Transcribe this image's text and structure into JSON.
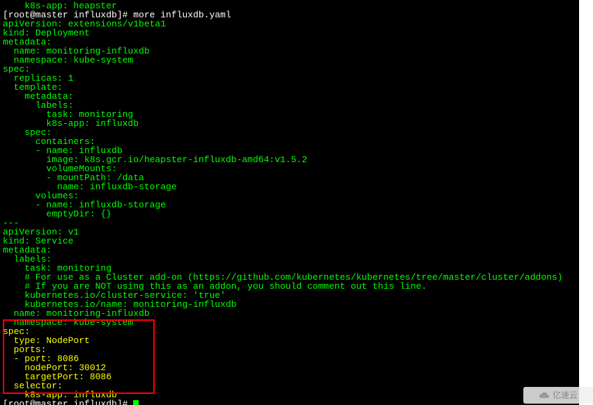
{
  "lines": [
    {
      "text": "    k8s-app: heapster",
      "cls": "green"
    },
    {
      "text": "[root@master influxdb]# more influxdb.yaml",
      "cls": "white"
    },
    {
      "text": "apiVersion: extensions/v1beta1",
      "cls": "green"
    },
    {
      "text": "kind: Deployment",
      "cls": "green"
    },
    {
      "text": "metadata:",
      "cls": "green"
    },
    {
      "text": "  name: monitoring-influxdb",
      "cls": "green"
    },
    {
      "text": "  namespace: kube-system",
      "cls": "green"
    },
    {
      "text": "spec:",
      "cls": "green"
    },
    {
      "text": "  replicas: 1",
      "cls": "green"
    },
    {
      "text": "  template:",
      "cls": "green"
    },
    {
      "text": "    metadata:",
      "cls": "green"
    },
    {
      "text": "      labels:",
      "cls": "green"
    },
    {
      "text": "        task: monitoring",
      "cls": "green"
    },
    {
      "text": "        k8s-app: influxdb",
      "cls": "green"
    },
    {
      "text": "    spec:",
      "cls": "green"
    },
    {
      "text": "      containers:",
      "cls": "green"
    },
    {
      "text": "      - name: influxdb",
      "cls": "green"
    },
    {
      "text": "        image: k8s.gcr.io/heapster-influxdb-amd64:v1.5.2",
      "cls": "green"
    },
    {
      "text": "        volumeMounts:",
      "cls": "green"
    },
    {
      "text": "        - mountPath: /data",
      "cls": "green"
    },
    {
      "text": "          name: influxdb-storage",
      "cls": "green"
    },
    {
      "text": "      volumes:",
      "cls": "green"
    },
    {
      "text": "      - name: influxdb-storage",
      "cls": "green"
    },
    {
      "text": "        emptyDir: {}",
      "cls": "green"
    },
    {
      "text": "---",
      "cls": "green"
    },
    {
      "text": "apiVersion: v1",
      "cls": "green"
    },
    {
      "text": "kind: Service",
      "cls": "green"
    },
    {
      "text": "metadata:",
      "cls": "green"
    },
    {
      "text": "  labels:",
      "cls": "green"
    },
    {
      "text": "    task: monitoring",
      "cls": "green"
    },
    {
      "text": "    # For use as a Cluster add-on (https://github.com/kubernetes/kubernetes/tree/master/cluster/addons)",
      "cls": "green"
    },
    {
      "text": "    # If you are NOT using this as an addon, you should comment out this line.",
      "cls": "green"
    },
    {
      "text": "    kubernetes.io/cluster-service: 'true'",
      "cls": "green"
    },
    {
      "text": "    kubernetes.io/name: monitoring-influxdb",
      "cls": "green"
    },
    {
      "text": "  name: monitoring-influxdb",
      "cls": "green"
    },
    {
      "text": "  namespace: kube-system",
      "cls": "green"
    },
    {
      "text": "spec:",
      "cls": "yellow"
    },
    {
      "text": "  type: NodePort",
      "cls": "yellow"
    },
    {
      "text": "  ports:",
      "cls": "yellow"
    },
    {
      "text": "  - port: 8086",
      "cls": "yellow"
    },
    {
      "text": "    nodePort: 30012",
      "cls": "yellow"
    },
    {
      "text": "    targetPort: 8086",
      "cls": "yellow"
    },
    {
      "text": "  selector:",
      "cls": "yellow"
    },
    {
      "text": "    k8s-app: influxdb",
      "cls": "yellow"
    }
  ],
  "prompt_final": "[root@master influxdb]# ",
  "watermark": "亿速云"
}
